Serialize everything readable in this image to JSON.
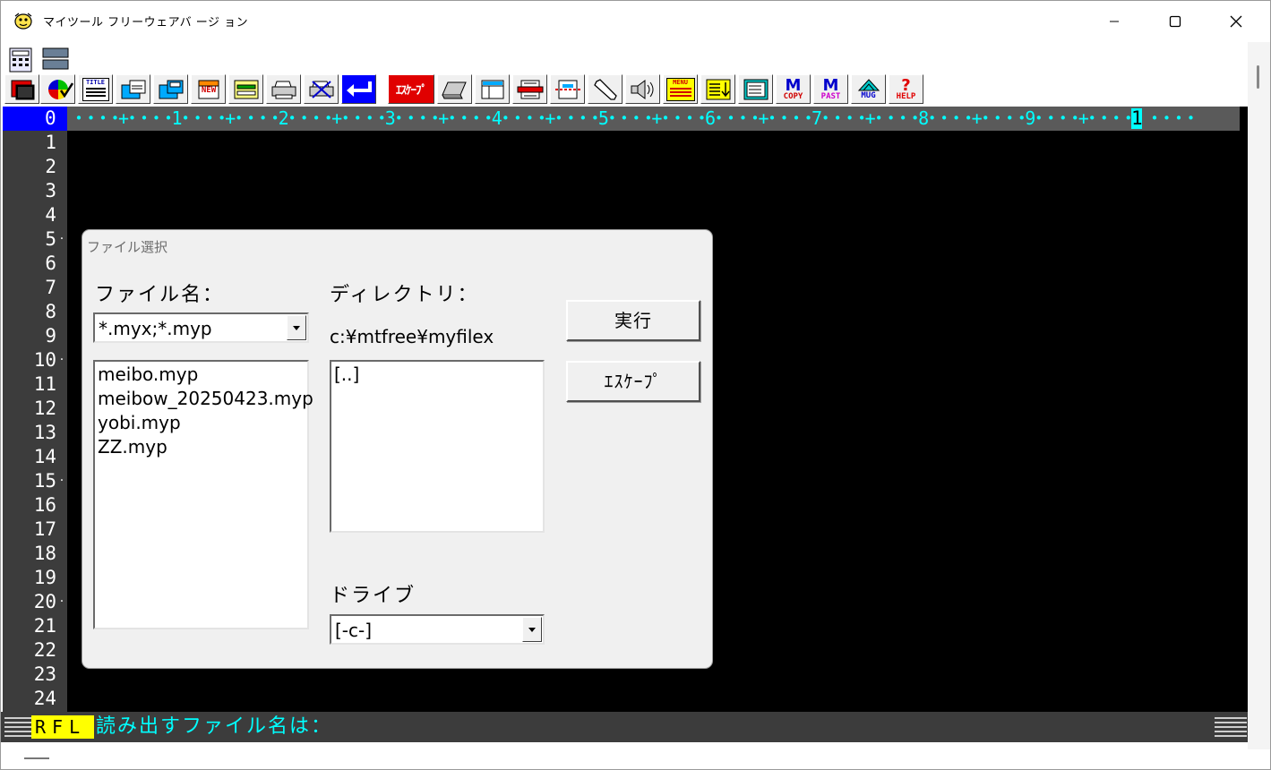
{
  "window": {
    "title": "マイツール フリーウェアバ ージ ョン"
  },
  "toolbar": {
    "title_label": "TITLE",
    "new_label": "NEW",
    "escape_label": "ｴｽｹｰﾌﾟ",
    "menu_label": "MENU",
    "copy_m": "M",
    "copy_label": "COPY",
    "paste_m": "M",
    "paste_label": "PAST",
    "mug_label": "MUG",
    "help_q": "?",
    "help_label": "HELP"
  },
  "ruler": {
    "zero": "0",
    "text": "・・・・+・・・・1・・・・+・・・・2・・・・+・・・・3・・・・+・・・・4・・・・+・・・・5・・・・+・・・・6・・・・+・・・・7・・・・+・・・・8・・・・+・・・・9・・・・+・・・・",
    "cursor": "1",
    "tail": "・・・・+・・・・"
  },
  "line_numbers": [
    "1",
    "2",
    "3",
    "4",
    "5",
    "6",
    "7",
    "8",
    "9",
    "10",
    "11",
    "12",
    "13",
    "14",
    "15",
    "16",
    "17",
    "18",
    "19",
    "20",
    "21",
    "22",
    "23",
    "24"
  ],
  "status": {
    "mode": "RFL",
    "prompt": "読み出すファイル名は："
  },
  "dialog": {
    "title": "ファイル選択",
    "filename_label": "ファイル名：",
    "filter_value": "*.myx;*.myp",
    "files": [
      "meibo.myp",
      "meibow_20250423.myp",
      "yobi.myp",
      "ZZ.myp"
    ],
    "directory_label": "ディレクトリ：",
    "directory_path": "c:¥mtfree¥myfilex",
    "directories": [
      "[..]"
    ],
    "drive_label": "ドライブ",
    "drive_value": "[-c-]",
    "execute_button": "実行",
    "escape_button": "ｴｽｹｰﾌﾟ"
  }
}
